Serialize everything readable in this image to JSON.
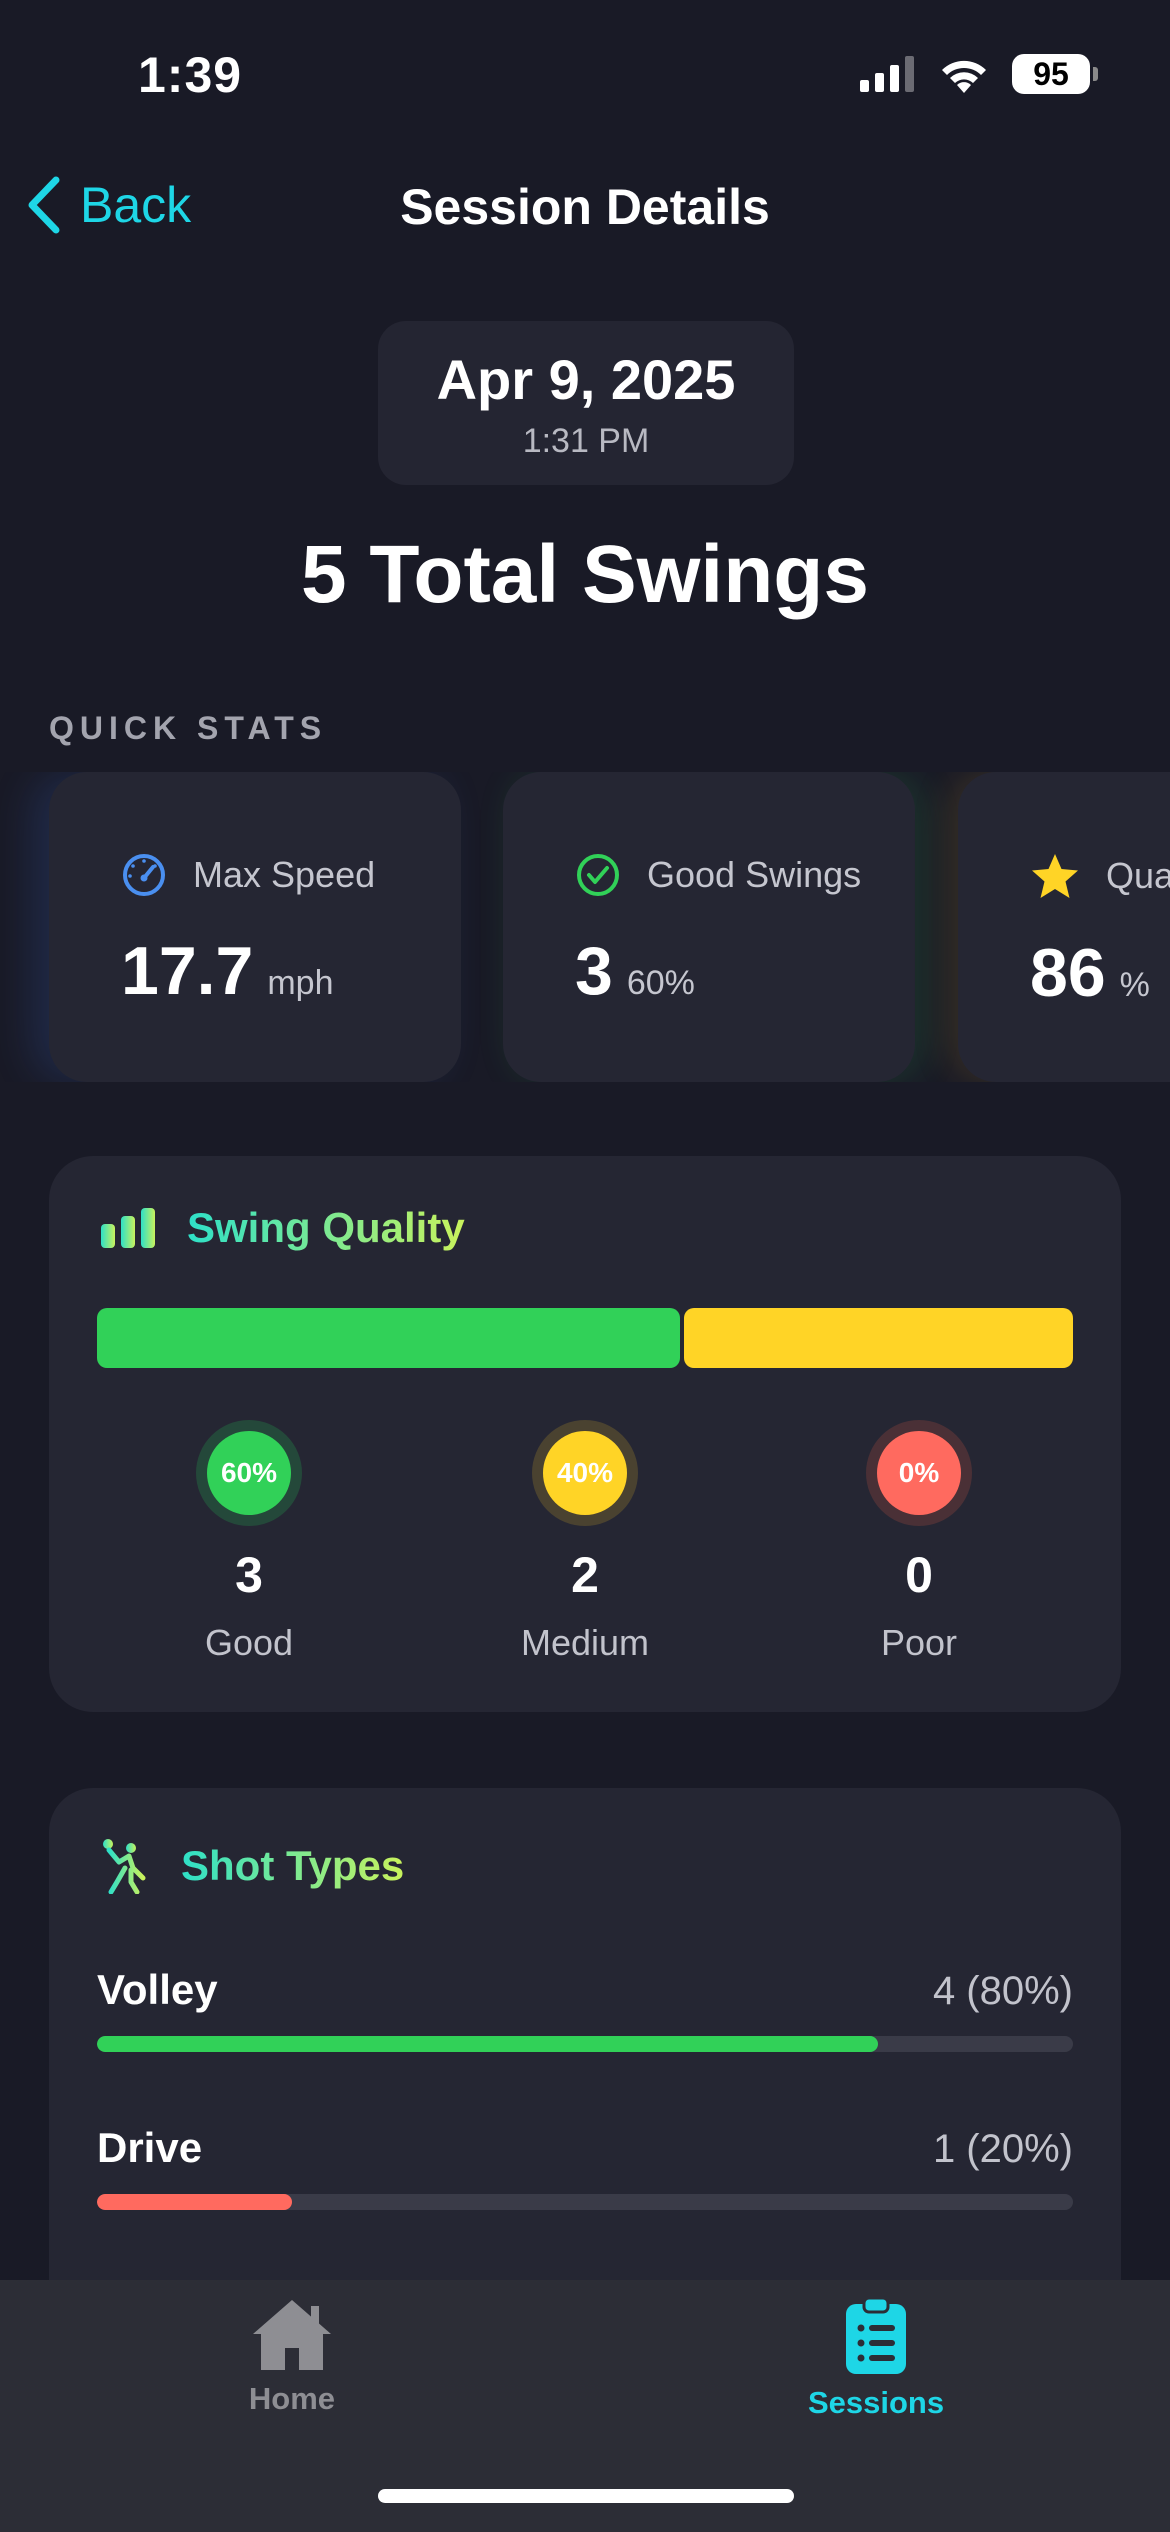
{
  "status_bar": {
    "time": "1:39",
    "battery": "95"
  },
  "nav": {
    "back_label": "Back",
    "title": "Session Details"
  },
  "session": {
    "date": "Apr 9, 2025",
    "time": "1:31 PM",
    "total_swings": "5 Total Swings"
  },
  "quick_stats": {
    "label": "QUICK STATS",
    "cards": [
      {
        "label": "Max Speed",
        "value": "17.7",
        "unit": "mph",
        "icon": "speedometer-icon",
        "color": "#4a8ff0"
      },
      {
        "label": "Good Swings",
        "value": "3",
        "unit": "60%",
        "icon": "check-circle-icon",
        "color": "#31d158"
      },
      {
        "label": "Quality",
        "label_visible": "Qual",
        "value": "86",
        "unit": "%",
        "icon": "star-icon",
        "color": "#ffd426"
      }
    ]
  },
  "swing_quality": {
    "title": "Swing Quality",
    "bar": [
      {
        "fraction": 0.6,
        "color": "#31d158"
      },
      {
        "fraction": 0.4,
        "color": "#ffd426"
      }
    ],
    "items": [
      {
        "percent": "60%",
        "count": "3",
        "label": "Good",
        "color": "#31d158",
        "ring": "#24483a"
      },
      {
        "percent": "40%",
        "count": "2",
        "label": "Medium",
        "color": "#ffd426",
        "ring": "#4a4230"
      },
      {
        "percent": "0%",
        "count": "0",
        "label": "Poor",
        "color": "#ff6a5f",
        "ring": "#4a3036"
      }
    ]
  },
  "shot_types": {
    "title": "Shot Types",
    "items": [
      {
        "name": "Volley",
        "value": "4 (80%)",
        "fraction": 0.8,
        "color": "#31d158"
      },
      {
        "name": "Drive",
        "value": "1 (20%)",
        "fraction": 0.2,
        "color": "#ff6a5f"
      }
    ]
  },
  "tab_bar": {
    "tabs": [
      {
        "label": "Home",
        "icon": "home-icon",
        "active": false,
        "color": "#8e8e93"
      },
      {
        "label": "Sessions",
        "icon": "clipboard-list-icon",
        "active": true,
        "color": "#1ed6e6"
      }
    ]
  }
}
